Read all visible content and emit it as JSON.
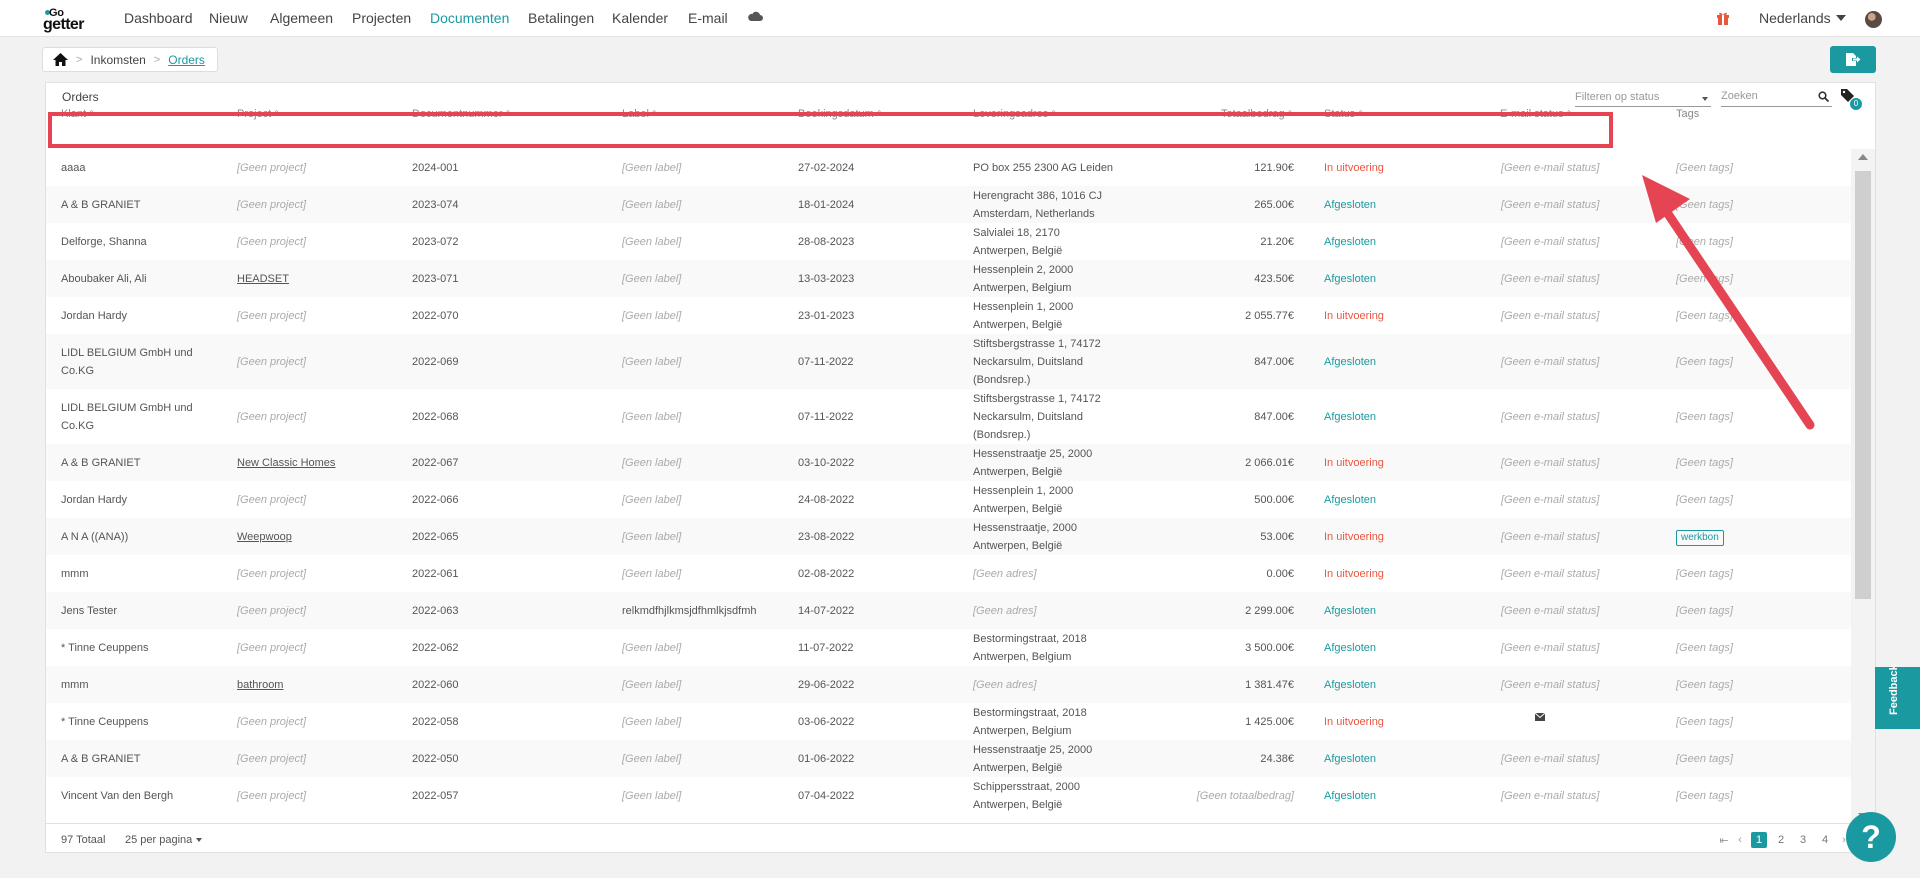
{
  "nav": {
    "logo_top": "Go",
    "logo_bottom": "getter",
    "items": [
      "Dashboard",
      "Nieuw",
      "Algemeen",
      "Projecten",
      "Documenten",
      "Betalingen",
      "Kalender",
      "E-mail"
    ],
    "language": "Nederlands"
  },
  "breadcrumb": {
    "items": [
      "Inkomsten",
      "Orders"
    ]
  },
  "panel": {
    "title": "Orders",
    "filter_placeholder": "Filteren op status",
    "search_placeholder": "Zoeken",
    "tag_count": "0"
  },
  "columns": [
    "Klant",
    "Project",
    "Documentnummer",
    "Label",
    "Boekingsdatum",
    "Leveringsadres",
    "Totaalbedrag",
    "Status",
    "E-mail status",
    "Tags"
  ],
  "rows": [
    {
      "klant": [
        "aaaa"
      ],
      "project": "[Geen project]",
      "project_muted": true,
      "doc": "2024-001",
      "label": "[Geen label]",
      "label_muted": true,
      "date": "27-02-2024",
      "adres": [
        "PO box 255 2300 AG Leiden"
      ],
      "adres_muted": false,
      "total": "121.90€",
      "total_muted": false,
      "status": "In uitvoering",
      "status_type": "exec",
      "email": "[Geen e-mail status]",
      "email_icon": false,
      "tags": "[Geen tags]",
      "tag_chip": false
    },
    {
      "klant": [
        "A & B GRANIET"
      ],
      "project": "[Geen project]",
      "project_muted": true,
      "doc": "2023-074",
      "label": "[Geen label]",
      "label_muted": true,
      "date": "18-01-2024",
      "adres": [
        "Herengracht 386, 1016 CJ",
        "Amsterdam, Netherlands"
      ],
      "adres_muted": false,
      "total": "265.00€",
      "total_muted": false,
      "status": "Afgesloten",
      "status_type": "done",
      "email": "[Geen e-mail status]",
      "email_icon": false,
      "tags": "[Geen tags]",
      "tag_chip": false
    },
    {
      "klant": [
        "Delforge, Shanna"
      ],
      "project": "[Geen project]",
      "project_muted": true,
      "doc": "2023-072",
      "label": "[Geen label]",
      "label_muted": true,
      "date": "28-08-2023",
      "adres": [
        "Salvialei 18, 2170",
        "Antwerpen, België"
      ],
      "adres_muted": false,
      "total": "21.20€",
      "total_muted": false,
      "status": "Afgesloten",
      "status_type": "done",
      "email": "[Geen e-mail status]",
      "email_icon": false,
      "tags": "[Geen tags]",
      "tag_chip": false
    },
    {
      "klant": [
        "Aboubaker Ali, Ali"
      ],
      "project": "HEADSET",
      "project_muted": false,
      "doc": "2023-071",
      "label": "[Geen label]",
      "label_muted": true,
      "date": "13-03-2023",
      "adres": [
        "Hessenplein 2, 2000",
        "Antwerpen, Belgium"
      ],
      "adres_muted": false,
      "total": "423.50€",
      "total_muted": false,
      "status": "Afgesloten",
      "status_type": "done",
      "email": "[Geen e-mail status]",
      "email_icon": false,
      "tags": "[Geen tags]",
      "tag_chip": false
    },
    {
      "klant": [
        "Jordan Hardy"
      ],
      "project": "[Geen project]",
      "project_muted": true,
      "doc": "2022-070",
      "label": "[Geen label]",
      "label_muted": true,
      "date": "23-01-2023",
      "adres": [
        "Hessenplein 1, 2000",
        "Antwerpen, België"
      ],
      "adres_muted": false,
      "total": "2 055.77€",
      "total_muted": false,
      "status": "In uitvoering",
      "status_type": "exec",
      "email": "[Geen e-mail status]",
      "email_icon": false,
      "tags": "[Geen tags]",
      "tag_chip": false
    },
    {
      "klant": [
        "LIDL BELGIUM GmbH und",
        "Co.KG"
      ],
      "project": "[Geen project]",
      "project_muted": true,
      "doc": "2022-069",
      "label": "[Geen label]",
      "label_muted": true,
      "date": "07-11-2022",
      "adres": [
        "Stiftsbergstrasse 1, 74172",
        "Neckarsulm, Duitsland",
        "(Bondsrep.)"
      ],
      "adres_muted": false,
      "total": "847.00€",
      "total_muted": false,
      "status": "Afgesloten",
      "status_type": "done",
      "email": "[Geen e-mail status]",
      "email_icon": false,
      "tags": "[Geen tags]",
      "tag_chip": false
    },
    {
      "klant": [
        "LIDL BELGIUM GmbH und",
        "Co.KG"
      ],
      "project": "[Geen project]",
      "project_muted": true,
      "doc": "2022-068",
      "label": "[Geen label]",
      "label_muted": true,
      "date": "07-11-2022",
      "adres": [
        "Stiftsbergstrasse 1, 74172",
        "Neckarsulm, Duitsland",
        "(Bondsrep.)"
      ],
      "adres_muted": false,
      "total": "847.00€",
      "total_muted": false,
      "status": "Afgesloten",
      "status_type": "done",
      "email": "[Geen e-mail status]",
      "email_icon": false,
      "tags": "[Geen tags]",
      "tag_chip": false
    },
    {
      "klant": [
        "A & B GRANIET"
      ],
      "project": "New Classic Homes",
      "project_muted": false,
      "doc": "2022-067",
      "label": "[Geen label]",
      "label_muted": true,
      "date": "03-10-2022",
      "adres": [
        "Hessenstraatje 25, 2000",
        "Antwerpen, België"
      ],
      "adres_muted": false,
      "total": "2 066.01€",
      "total_muted": false,
      "status": "In uitvoering",
      "status_type": "exec",
      "email": "[Geen e-mail status]",
      "email_icon": false,
      "tags": "[Geen tags]",
      "tag_chip": false
    },
    {
      "klant": [
        "Jordan Hardy"
      ],
      "project": "[Geen project]",
      "project_muted": true,
      "doc": "2022-066",
      "label": "[Geen label]",
      "label_muted": true,
      "date": "24-08-2022",
      "adres": [
        "Hessenplein 1, 2000",
        "Antwerpen, België"
      ],
      "adres_muted": false,
      "total": "500.00€",
      "total_muted": false,
      "status": "Afgesloten",
      "status_type": "done",
      "email": "[Geen e-mail status]",
      "email_icon": false,
      "tags": "[Geen tags]",
      "tag_chip": false
    },
    {
      "klant": [
        "A N A ((ANA))"
      ],
      "project": "Weepwoop",
      "project_muted": false,
      "doc": "2022-065",
      "label": "[Geen label]",
      "label_muted": true,
      "date": "23-08-2022",
      "adres": [
        "Hessenstraatje, 2000",
        "Antwerpen, België"
      ],
      "adres_muted": false,
      "total": "53.00€",
      "total_muted": false,
      "status": "In uitvoering",
      "status_type": "exec",
      "email": "[Geen e-mail status]",
      "email_icon": false,
      "tags": "werkbon",
      "tag_chip": true
    },
    {
      "klant": [
        "mmm"
      ],
      "project": "[Geen project]",
      "project_muted": true,
      "doc": "2022-061",
      "label": "[Geen label]",
      "label_muted": true,
      "date": "02-08-2022",
      "adres": [
        "[Geen adres]"
      ],
      "adres_muted": true,
      "total": "0.00€",
      "total_muted": false,
      "status": "In uitvoering",
      "status_type": "exec",
      "email": "[Geen e-mail status]",
      "email_icon": false,
      "tags": "[Geen tags]",
      "tag_chip": false
    },
    {
      "klant": [
        "Jens Tester"
      ],
      "project": "[Geen project]",
      "project_muted": true,
      "doc": "2022-063",
      "label": "relkmdfhjlkmsjdfhmlkjsdfmh",
      "label_muted": false,
      "date": "14-07-2022",
      "adres": [
        "[Geen adres]"
      ],
      "adres_muted": true,
      "total": "2 299.00€",
      "total_muted": false,
      "status": "Afgesloten",
      "status_type": "done",
      "email": "[Geen e-mail status]",
      "email_icon": false,
      "tags": "[Geen tags]",
      "tag_chip": false
    },
    {
      "klant": [
        "* Tinne Ceuppens"
      ],
      "project": "[Geen project]",
      "project_muted": true,
      "doc": "2022-062",
      "label": "[Geen label]",
      "label_muted": true,
      "date": "11-07-2022",
      "adres": [
        "Bestormingstraat, 2018",
        "Antwerpen, Belgium"
      ],
      "adres_muted": false,
      "total": "3 500.00€",
      "total_muted": false,
      "status": "Afgesloten",
      "status_type": "done",
      "email": "[Geen e-mail status]",
      "email_icon": false,
      "tags": "[Geen tags]",
      "tag_chip": false
    },
    {
      "klant": [
        "mmm"
      ],
      "project": "bathroom",
      "project_muted": false,
      "doc": "2022-060",
      "label": "[Geen label]",
      "label_muted": true,
      "date": "29-06-2022",
      "adres": [
        "[Geen adres]"
      ],
      "adres_muted": true,
      "total": "1 381.47€",
      "total_muted": false,
      "status": "Afgesloten",
      "status_type": "done",
      "email": "[Geen e-mail status]",
      "email_icon": false,
      "tags": "[Geen tags]",
      "tag_chip": false
    },
    {
      "klant": [
        "* Tinne Ceuppens"
      ],
      "project": "[Geen project]",
      "project_muted": true,
      "doc": "2022-058",
      "label": "[Geen label]",
      "label_muted": true,
      "date": "03-06-2022",
      "adres": [
        "Bestormingstraat, 2018",
        "Antwerpen, Belgium"
      ],
      "adres_muted": false,
      "total": "1 425.00€",
      "total_muted": false,
      "status": "In uitvoering",
      "status_type": "exec",
      "email": "",
      "email_icon": true,
      "tags": "[Geen tags]",
      "tag_chip": false
    },
    {
      "klant": [
        "A & B GRANIET"
      ],
      "project": "[Geen project]",
      "project_muted": true,
      "doc": "2022-050",
      "label": "[Geen label]",
      "label_muted": true,
      "date": "01-06-2022",
      "adres": [
        "Hessenstraatje 25, 2000",
        "Antwerpen, België"
      ],
      "adres_muted": false,
      "total": "24.38€",
      "total_muted": false,
      "status": "Afgesloten",
      "status_type": "done",
      "email": "[Geen e-mail status]",
      "email_icon": false,
      "tags": "[Geen tags]",
      "tag_chip": false
    },
    {
      "klant": [
        "Vincent Van den Bergh"
      ],
      "project": "[Geen project]",
      "project_muted": true,
      "doc": "2022-057",
      "label": "[Geen label]",
      "label_muted": true,
      "date": "07-04-2022",
      "adres": [
        "Schippersstraat, 2000",
        "Antwerpen, België"
      ],
      "adres_muted": false,
      "total": "[Geen totaalbedrag]",
      "total_muted": true,
      "status": "Afgesloten",
      "status_type": "done",
      "email": "[Geen e-mail status]",
      "email_icon": false,
      "tags": "[Geen tags]",
      "tag_chip": false
    }
  ],
  "footer": {
    "total": "97 Totaal",
    "per_page": "25 per pagina",
    "pages": [
      "1",
      "2",
      "3",
      "4"
    ],
    "active_page": "1"
  },
  "feedback_label": "Feedback",
  "help_label": "?",
  "colors": {
    "accent": "#1a9aa0",
    "status_exec": "#e9573f",
    "highlight": "#e54552"
  },
  "icons": [
    "cloud-icon",
    "gift-icon",
    "home-icon",
    "export-icon",
    "search-icon",
    "tag-icon",
    "mail-icon"
  ]
}
